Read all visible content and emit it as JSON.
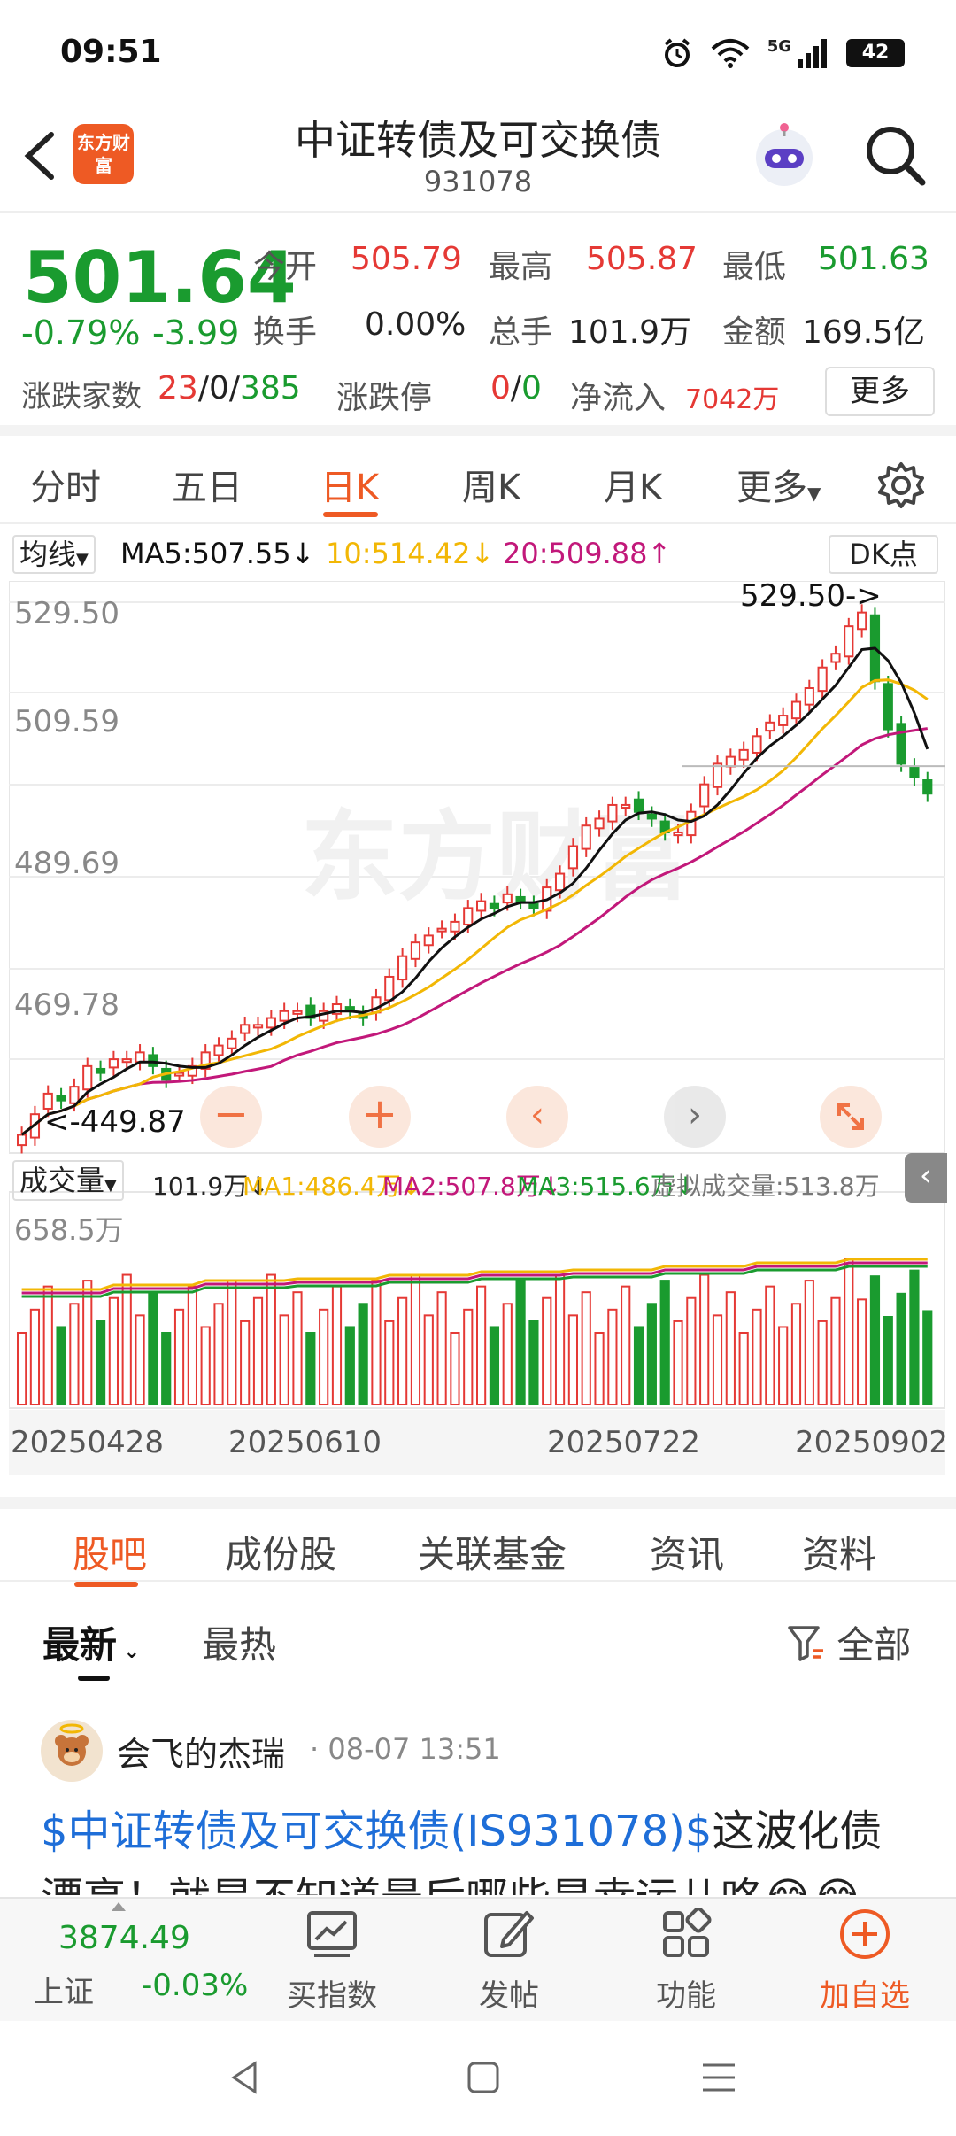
{
  "status_bar": {
    "time": "09:51",
    "network": "5G",
    "battery": "42"
  },
  "header": {
    "title": "中证转债及可交换债",
    "code": "931078",
    "logo_text": "东方财富"
  },
  "quote": {
    "price": "501.64",
    "change_pct": "-0.79%",
    "change": "-3.99",
    "open_label": "今开",
    "open": "505.79",
    "high_label": "最高",
    "high": "505.87",
    "low_label": "最低",
    "low": "501.63",
    "turnover_label": "换手",
    "turnover": "0.00%",
    "volume_label": "总手",
    "volume": "101.9万",
    "amount_label": "金额",
    "amount": "169.5亿",
    "breadth_label": "涨跌家数",
    "up": "23",
    "flat": "0",
    "down": "385",
    "limit_label": "涨跌停",
    "limit_up": "0",
    "limit_down": "0",
    "netflow_label": "净流入",
    "netflow": "7042万",
    "more": "更多"
  },
  "k_tabs": [
    "分时",
    "五日",
    "日K",
    "周K",
    "月K",
    "更多"
  ],
  "ma_legend": {
    "selector": "均线",
    "ma5": "MA5:507.55↓",
    "ma10": "10:514.42↓",
    "ma20": "20:509.88↑",
    "dk": "DK点"
  },
  "chart_data": {
    "type": "candlestick",
    "price_axis_labels": [
      "529.50",
      "509.59",
      "489.69",
      "469.78"
    ],
    "high_marker": "529.50->",
    "low_marker": "449.87",
    "date_labels": [
      "20250428",
      "20250610",
      "20250722",
      "20250902"
    ],
    "volume_axis_label": "658.5万",
    "ylim": [
      449.87,
      529.5
    ],
    "closes": [
      452,
      455,
      458,
      457,
      459,
      462,
      461,
      463,
      463,
      464,
      462,
      460,
      461,
      462,
      464,
      465,
      466,
      468,
      468,
      469,
      470,
      470,
      469,
      470,
      471,
      470,
      469,
      472,
      475,
      478,
      480,
      481,
      482,
      483,
      485,
      486,
      485,
      487,
      486,
      485,
      488,
      490,
      494,
      497,
      498,
      500,
      500,
      499,
      498,
      496,
      496,
      499,
      503,
      506,
      507,
      508,
      510,
      512,
      513,
      515,
      517,
      520,
      522,
      526,
      528,
      518,
      511,
      506,
      504,
      501.64
    ],
    "volume": [
      {
        "name": "成交量",
        "value": "101.9万↓"
      },
      {
        "name": "MA1",
        "value": "486.4万↓"
      },
      {
        "name": "MA2",
        "value": "507.8万↓"
      },
      {
        "name": "MA3",
        "value": "515.6万↓"
      },
      {
        "name": "虚拟成交量",
        "value": "513.8万"
      }
    ]
  },
  "vol_legend": {
    "selector": "成交量",
    "vol": "101.9万↓",
    "ma1": "MA1:486.4万↓",
    "ma2": "MA2:507.8万↓",
    "ma3": "MA3:515.6万↓",
    "virt": "虚拟成交量:513.8万"
  },
  "content_tabs": [
    "股吧",
    "成份股",
    "关联基金",
    "资讯",
    "资料"
  ],
  "sub_tabs": {
    "latest": "最新",
    "hot": "最热",
    "filter": "全部"
  },
  "post": {
    "author": "会飞的杰瑞",
    "time": "· 08-07 13:51",
    "link": "$中证转债及可交换债(IS931078)$",
    "text": "这波化债",
    "line2": "漂亮！就是不知道最后哪些是幸运儿咯😂😂"
  },
  "bottom_bar": {
    "index_value": "3874.49",
    "index_name": "上证",
    "index_change": "-0.03%",
    "buy_index": "买指数",
    "post": "发帖",
    "functions": "功能",
    "add_watch": "加自选"
  },
  "colors": {
    "up": "#e53935",
    "down": "#1a9b2f",
    "accent": "#ee5a24",
    "ma5": "#111111",
    "ma10": "#f2b705",
    "ma20": "#c2187a"
  }
}
